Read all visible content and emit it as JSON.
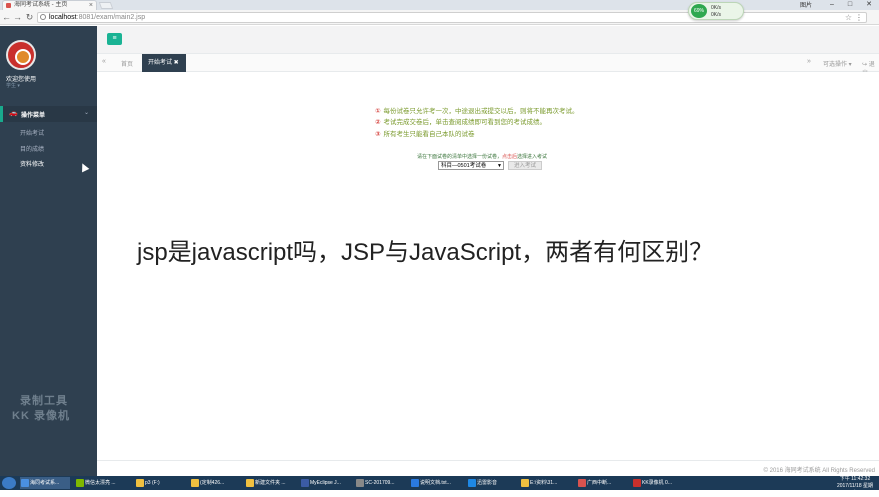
{
  "browser": {
    "tab_title": "海同考试系统 - 主页",
    "tab_close": "×",
    "url_host": "localhost",
    "url_path": ":8081/exam/main2.jsp",
    "user_label": "图片",
    "speed_badge": {
      "percent": "69%",
      "up": "0K/s",
      "down": "0K/s"
    }
  },
  "sidebar": {
    "welcome": "欢迎您使用",
    "role": "学生 ▾",
    "menu_header": "操作菜单",
    "items": [
      "开始考试",
      "目的成绩",
      "资料修改"
    ],
    "watermark_line1": "录制工具",
    "watermark_line2": "KK 录像机"
  },
  "tabs": {
    "home": "首页",
    "current": "开始考试 ✖",
    "ops": "可选操作 ▾",
    "exit": "↪ 退出"
  },
  "content": {
    "rules": [
      {
        "num": "①",
        "text": "每份试卷只允许考一次，中途退出或提交以后，则将不能再次考试。"
      },
      {
        "num": "②",
        "text": "考试完成交卷后，单击查阅成绩即可看到您的考试成绩。"
      },
      {
        "num": "③",
        "text": "所有考生只能看自己本队的试卷"
      }
    ],
    "hint_prefix": "请在下面试卷的清单中选择一份试卷，",
    "hint_red": "点击后",
    "hint_suffix": "选择进入考试",
    "select_value": "科目—0501考试卷",
    "enter_button": "进入考试"
  },
  "footer": "© 2016 海同考试系统 All Rights Reserved",
  "overlay_text": "jsp是javascript吗，JSP与JavaScript，两者有何区别？",
  "taskbar": {
    "tasks": [
      "海同考试系...",
      "微信太漂亮 ...",
      "p3 (F:)",
      "(定制426...",
      "新建文件夹 ...",
      "MyEclipse J...",
      "SC-201709...",
      "说明文档.txt...",
      "迅雷影音",
      "E:\\资料\\31...",
      "广西中断...",
      "KK录像机 0..."
    ],
    "clock_time": "下午 11:42:32",
    "clock_date": "2017/11/18 星期六"
  }
}
